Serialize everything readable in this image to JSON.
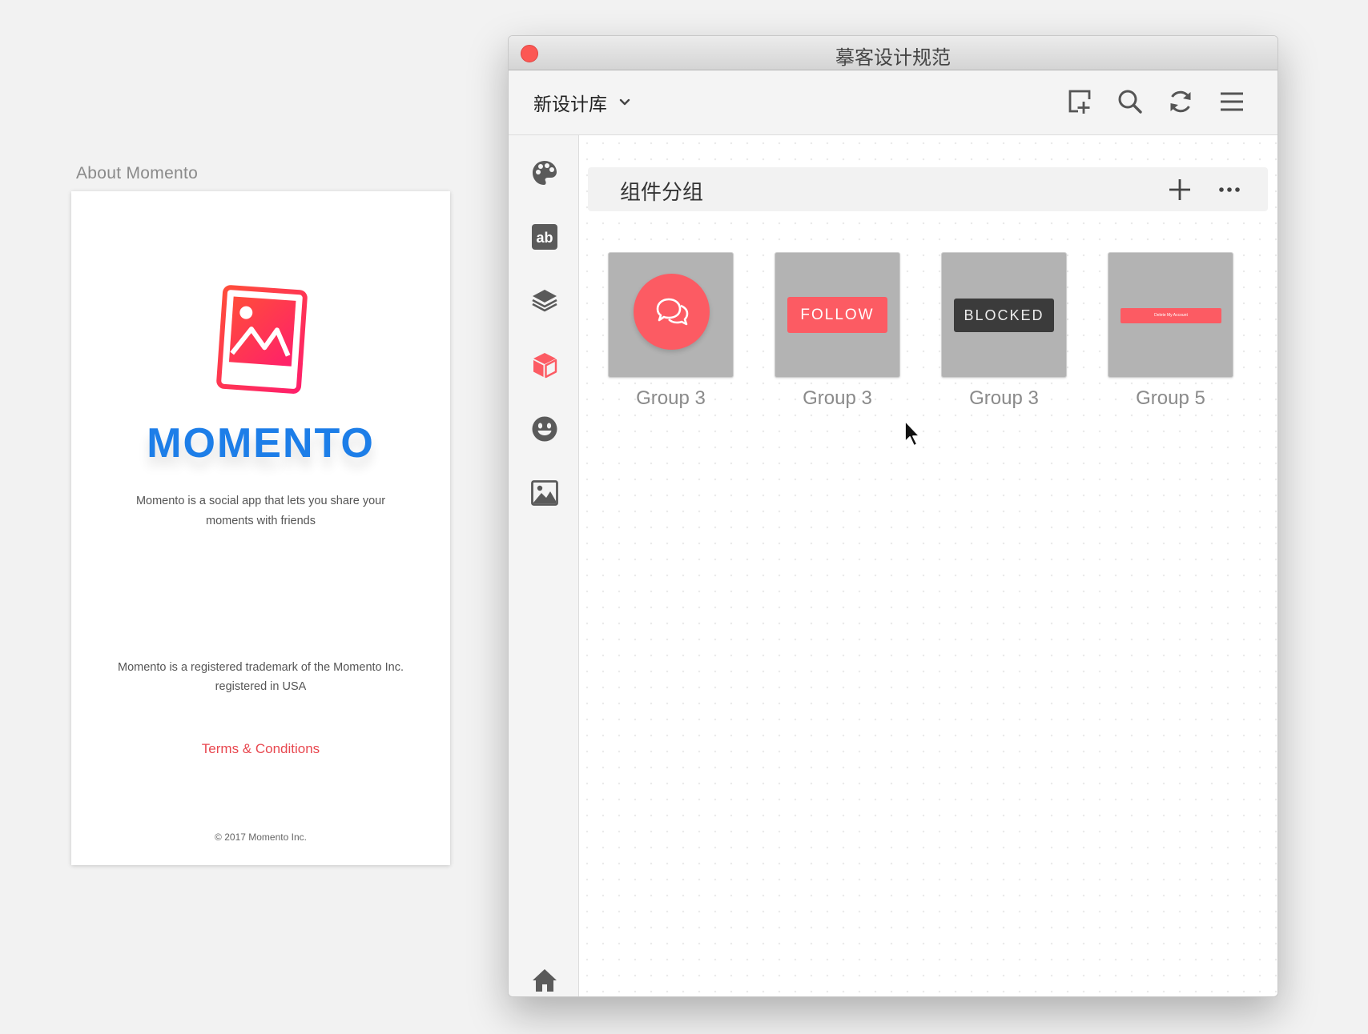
{
  "artboard": {
    "label": "About Momento",
    "app_name": "MOMENTO",
    "description": "Momento is a social app that lets you share your moments with friends",
    "trademark": "Momento is a registered trademark of the Momento Inc. registered in USA",
    "terms_link": "Terms & Conditions",
    "copyright": "© 2017 Momento Inc."
  },
  "window": {
    "title": "摹客设计规范",
    "library_name": "新设计库",
    "toolbar_icons": [
      "add-artboard-icon",
      "search-icon",
      "sync-icon",
      "menu-icon"
    ],
    "sidebar_icons": [
      "palette-icon",
      "text-style-icon",
      "layers-icon",
      "component-icon",
      "emoji-icon",
      "image-icon",
      "home-icon"
    ],
    "active_sidebar": "component-icon",
    "group_title": "组件分组",
    "cards": [
      {
        "label": "Group 3",
        "preview": "chat-bubble-button"
      },
      {
        "label": "Group 3",
        "preview": "follow-button",
        "text": "FOLLOW"
      },
      {
        "label": "Group 3",
        "preview": "blocked-button",
        "text": "BLOCKED"
      },
      {
        "label": "Group 5",
        "preview": "delete-account-button",
        "text": "Delete My Account"
      }
    ]
  },
  "colors": {
    "accent": "#fc5b63",
    "brand_blue": "#1d7ee8",
    "icon_gray": "#5a5a5a"
  }
}
